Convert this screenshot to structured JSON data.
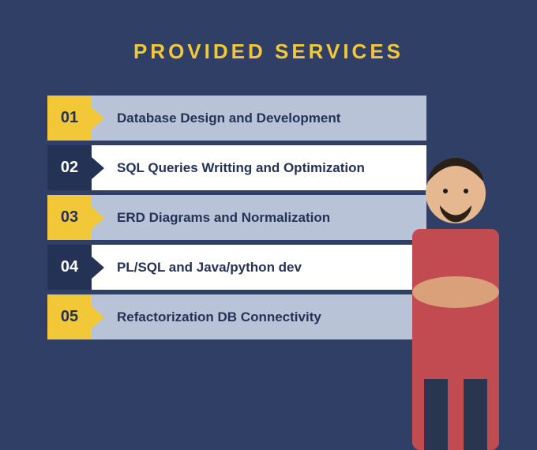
{
  "title": "PROVIDED SERVICES",
  "items": [
    {
      "num": "01",
      "label": "Database Design and Development",
      "numStyle": "num-yellow",
      "bgStyle": "bg-light"
    },
    {
      "num": "02",
      "label": "SQL Queries Writting and Optimization",
      "numStyle": "num-navy",
      "bgStyle": "bg-white"
    },
    {
      "num": "03",
      "label": "ERD Diagrams and Normalization",
      "numStyle": "num-yellow",
      "bgStyle": "bg-light"
    },
    {
      "num": "04",
      "label": "PL/SQL and Java/python dev",
      "numStyle": "num-navy",
      "bgStyle": "bg-white"
    },
    {
      "num": "05",
      "label": "Refactorization DB Connectivity",
      "numStyle": "num-yellow",
      "bgStyle": "bg-light"
    }
  ],
  "person_alt": "Person with crossed arms"
}
